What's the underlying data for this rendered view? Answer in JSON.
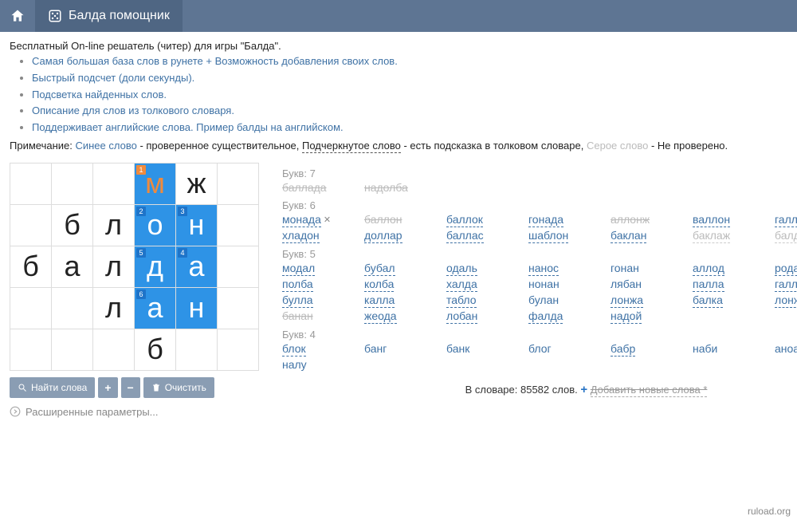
{
  "header": {
    "title": "Балда помощник"
  },
  "intro": "Бесплатный On-line решатель (читер) для игры \"Балда\".",
  "features": [
    "Самая большая база слов в рунете + Возможность добавления своих слов.",
    "Быстрый подсчет (доли секунды).",
    "Подсветка найденных слов.",
    "Описание для слов из толкового словаря.",
    "Поддерживает английские слова. "
  ],
  "english_example_link": "Пример балды на английском",
  "note_prefix": "Примечание: ",
  "note_blue": "Синее слово",
  "note_blue_desc": " - проверенное существительное, ",
  "note_underlined": "Подчеркнутое слово",
  "note_underlined_desc": " - есть подсказка в толковом словаре, ",
  "note_gray": "Серое слово",
  "note_gray_desc": " - Не проверено.",
  "grid": [
    [
      "",
      "",
      "",
      "м",
      "ж",
      ""
    ],
    [
      "",
      "б",
      "л",
      "о",
      "н",
      ""
    ],
    [
      "б",
      "а",
      "л",
      "д",
      "а",
      ""
    ],
    [
      "",
      "",
      "л",
      "а",
      "н",
      ""
    ],
    [
      "",
      "",
      "",
      "б",
      "",
      ""
    ]
  ],
  "grid_hl": [
    [
      0,
      3
    ],
    [
      1,
      3
    ],
    [
      1,
      4
    ],
    [
      2,
      3
    ],
    [
      2,
      4
    ],
    [
      3,
      3
    ],
    [
      3,
      4
    ]
  ],
  "grid_new": [
    [
      0,
      3
    ]
  ],
  "grid_tags": [
    {
      "r": 0,
      "c": 3,
      "n": "1",
      "cls": "tag-orange"
    },
    {
      "r": 1,
      "c": 3,
      "n": "2",
      "cls": "tag-blue"
    },
    {
      "r": 1,
      "c": 4,
      "n": "3",
      "cls": "tag-blue"
    },
    {
      "r": 2,
      "c": 3,
      "n": "5",
      "cls": "tag-blue"
    },
    {
      "r": 2,
      "c": 4,
      "n": "4",
      "cls": "tag-blue"
    },
    {
      "r": 3,
      "c": 3,
      "n": "6",
      "cls": "tag-blue"
    }
  ],
  "controls": {
    "find": "Найти слова",
    "clear": "Очистить",
    "advanced": "Расширенные параметры..."
  },
  "groups": [
    {
      "label": "Букв: 7",
      "rows": [
        [
          {
            "w": "баллада",
            "cls": "strike"
          },
          {
            "w": "надолба",
            "cls": "strike"
          }
        ]
      ]
    },
    {
      "label": "Букв: 6",
      "rows": [
        [
          {
            "w": "монада",
            "cls": "selected",
            "x": true
          },
          {
            "w": "баллон",
            "cls": "strike"
          },
          {
            "w": "баллок"
          },
          {
            "w": "гонада"
          },
          {
            "w": "аллонж",
            "cls": "strike"
          },
          {
            "w": "валлон"
          },
          {
            "w": "галлон"
          }
        ],
        [
          {
            "w": "хладон"
          },
          {
            "w": "доллар"
          },
          {
            "w": "баллас"
          },
          {
            "w": "шаблон"
          },
          {
            "w": "баклан"
          },
          {
            "w": "баклаж",
            "cls": "gray"
          },
          {
            "w": "балдан",
            "cls": "gray"
          }
        ]
      ]
    },
    {
      "label": "Букв: 5",
      "rows": [
        [
          {
            "w": "модал"
          },
          {
            "w": "бубал"
          },
          {
            "w": "одаль"
          },
          {
            "w": "нанос"
          },
          {
            "w": "гонан",
            "cls": "plain"
          },
          {
            "w": "аллод"
          },
          {
            "w": "родан"
          }
        ],
        [
          {
            "w": "полба"
          },
          {
            "w": "колба"
          },
          {
            "w": "халда"
          },
          {
            "w": "нонан",
            "cls": "plain"
          },
          {
            "w": "лябан",
            "cls": "plain"
          },
          {
            "w": "палла"
          },
          {
            "w": "галла"
          }
        ],
        [
          {
            "w": "булла"
          },
          {
            "w": "калла"
          },
          {
            "w": "табло"
          },
          {
            "w": "булан",
            "cls": "plain"
          },
          {
            "w": "лонжа"
          },
          {
            "w": "балка"
          },
          {
            "w": "лонжа"
          }
        ],
        [
          {
            "w": "банан",
            "cls": "strike"
          },
          {
            "w": "жеода"
          },
          {
            "w": "лобан"
          },
          {
            "w": "фалда"
          },
          {
            "w": "надой"
          }
        ]
      ]
    },
    {
      "label": "Букв: 4",
      "rows": [
        [
          {
            "w": "блок"
          },
          {
            "w": "банг",
            "cls": "plain"
          },
          {
            "w": "банк",
            "cls": "plain"
          },
          {
            "w": "блог",
            "cls": "plain"
          },
          {
            "w": "бабр"
          },
          {
            "w": "наби",
            "cls": "plain"
          },
          {
            "w": "аноа",
            "cls": "plain"
          }
        ],
        [
          {
            "w": "налу",
            "cls": "plain"
          }
        ]
      ]
    }
  ],
  "dict_info": {
    "prefix": "В словаре: ",
    "count": "85582",
    "suffix": " слов. ",
    "add_link": "Добавить новые слова *"
  },
  "watermark": "ruload.org"
}
